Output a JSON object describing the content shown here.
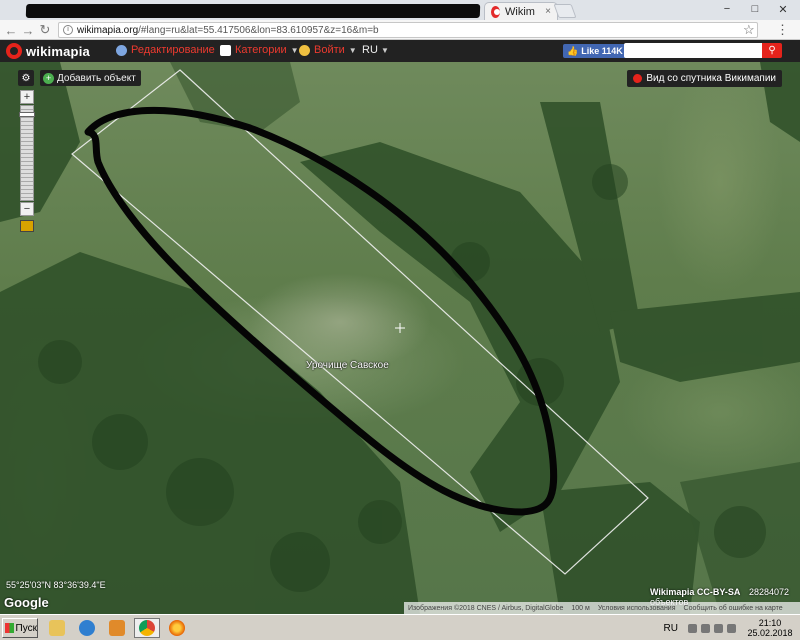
{
  "browser": {
    "tabs": [
      {
        "title": "Wikimapia - Это карта мира...",
        "close": "×"
      }
    ],
    "window_controls": {
      "minimize": "−",
      "maximize": "□",
      "close": "✕"
    },
    "address": {
      "host": "wikimapia.org",
      "path": "/#lang=ru&lat=55.417506&lon=83.610957&z=16&m=b"
    },
    "icons": {
      "back": "arrow-left-icon",
      "forward": "arrow-right-icon",
      "reload": "reload-icon",
      "bookmark": "star-icon",
      "menu": "dots-icon"
    }
  },
  "header": {
    "logo": "wikimapia",
    "menus": [
      {
        "label": "Редактирование",
        "icon": "globe-icon",
        "color": "#7ea6e0"
      },
      {
        "label": "Категории",
        "icon": "flag-icon",
        "color": "#ffffff"
      },
      {
        "label": "Войти",
        "icon": "user-icon",
        "color": "#f0c040"
      }
    ],
    "language": "RU",
    "like": {
      "label": "Like",
      "count": "114K"
    },
    "search": {
      "placeholder": "",
      "button_icon": "search-icon"
    }
  },
  "map": {
    "add_object": "Добавить объект",
    "satellite_button": "Вид со спутника Викимапии",
    "place_label": "Урочище Савское",
    "coordinates": "55°25'03\"N 83°36'39.4\"E",
    "google_logo": "Google",
    "zoom": {
      "in": "+",
      "out": "−"
    },
    "attribution": [
      "Изображения ©2018 CNES / Airbus, DigitalGlobe",
      "100 м",
      "Условия использования",
      "Сообщить об ошибке на карте"
    ],
    "license": "Wikimapia CC-BY-SA",
    "object_count": "28284072 объектов"
  },
  "taskbar": {
    "start": "Пуск",
    "apps": [
      "file-manager-icon",
      "internet-explorer-icon",
      "media-player-icon",
      "chrome-icon",
      "firefox-icon"
    ],
    "tray_language": "RU",
    "time": "21:10",
    "date": "25.02.2018"
  },
  "colors": {
    "wikimapia_red": "#e5231b",
    "header_bg": "#222222",
    "facebook_blue": "#4267b2",
    "outline_ink": "#000000"
  }
}
